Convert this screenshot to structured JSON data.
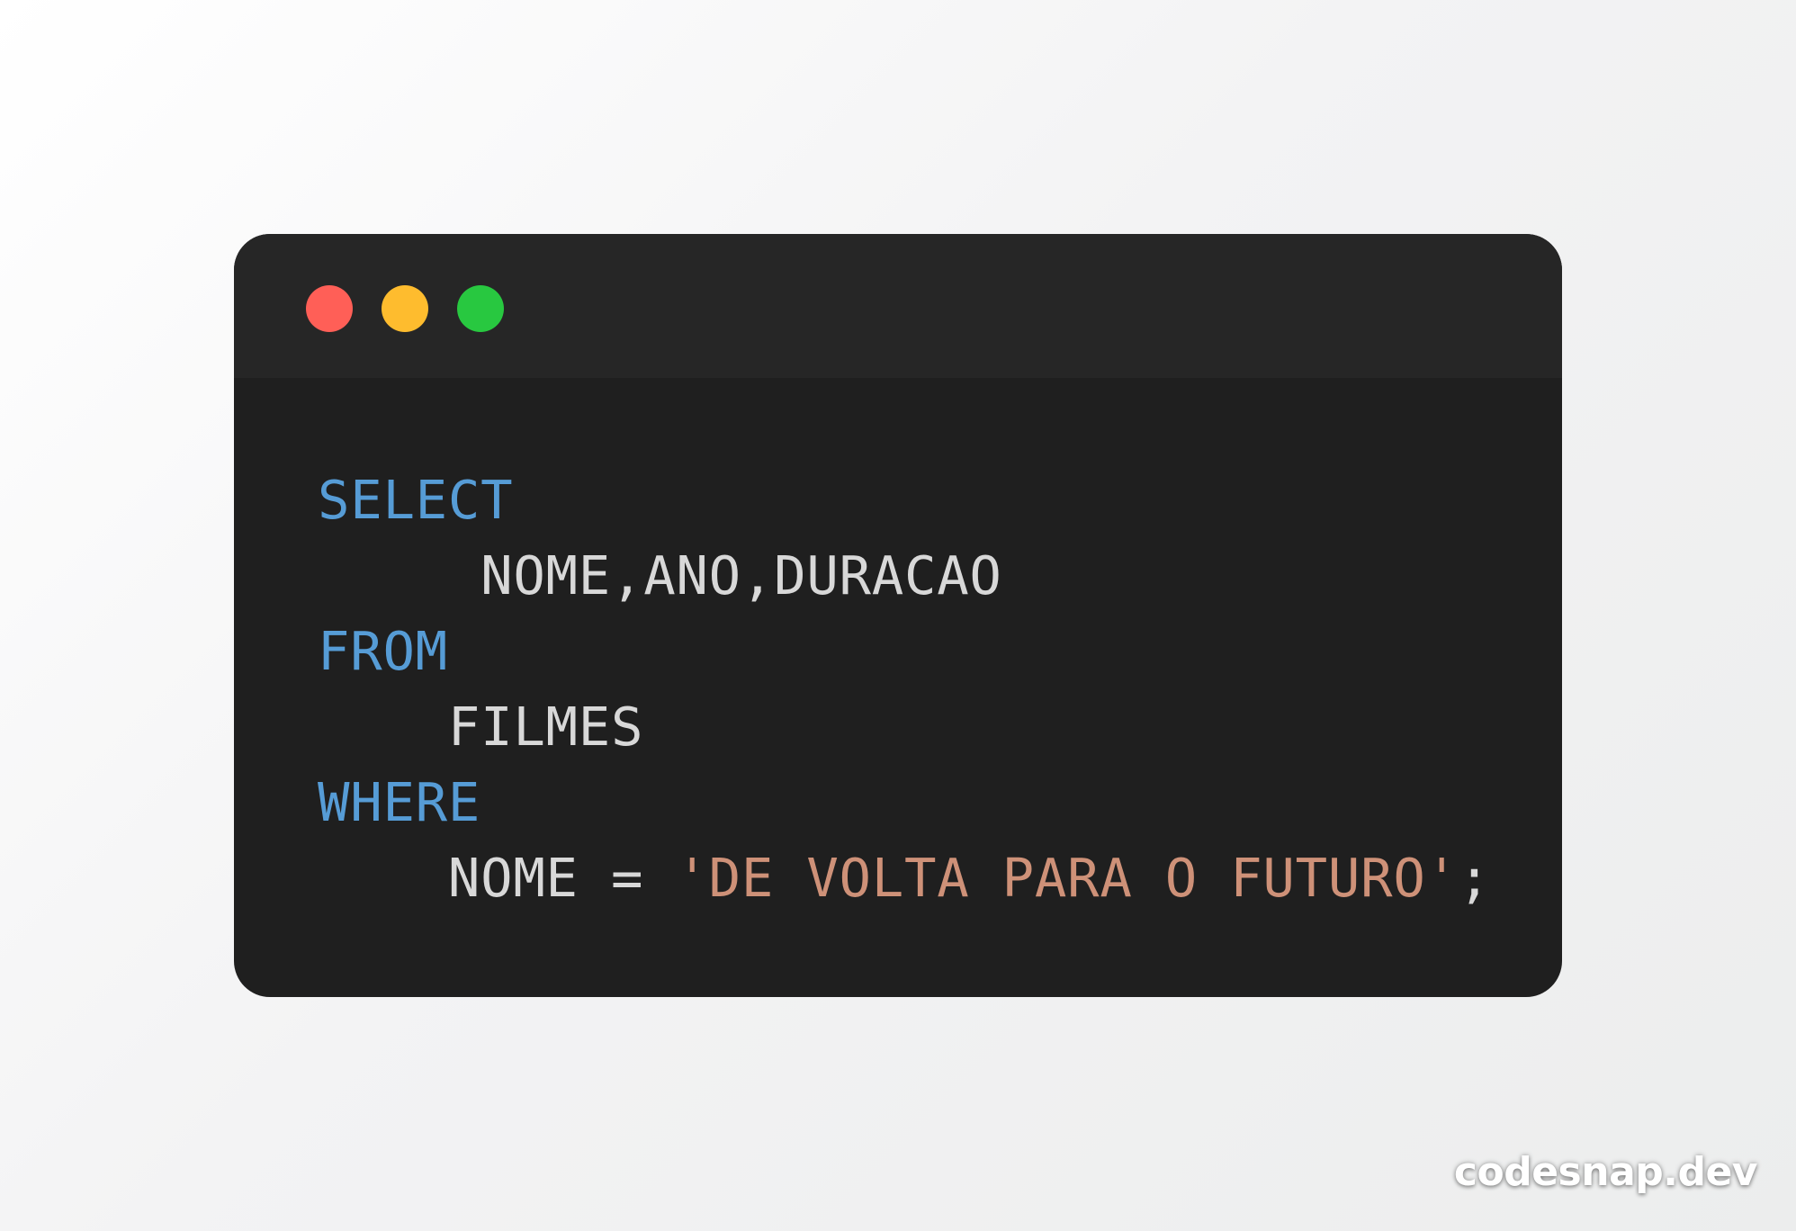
{
  "window": {
    "traffic_lights": [
      {
        "name": "close",
        "color": "#ff5f57"
      },
      {
        "name": "minimize",
        "color": "#febc2e"
      },
      {
        "name": "maximize",
        "color": "#28c840"
      }
    ]
  },
  "code": {
    "language": "SQL",
    "lines": [
      {
        "keyword": "SELECT"
      },
      {
        "indent": "     ",
        "text": "NOME,ANO,DURACAO"
      },
      {
        "keyword": "FROM"
      },
      {
        "indent": "    ",
        "text": "FILMES"
      },
      {
        "keyword": "WHERE"
      },
      {
        "indent": "    ",
        "text": "NOME = ",
        "string": "'DE VOLTA PARA O FUTURO'",
        "tail": ";"
      }
    ],
    "colors": {
      "keyword": "#569cd6",
      "string": "#ce9178",
      "plain": "#d8d8d8",
      "background": "#1f1f1f",
      "titlebar": "#262626"
    }
  },
  "watermark": {
    "text": "codesnap.dev"
  }
}
